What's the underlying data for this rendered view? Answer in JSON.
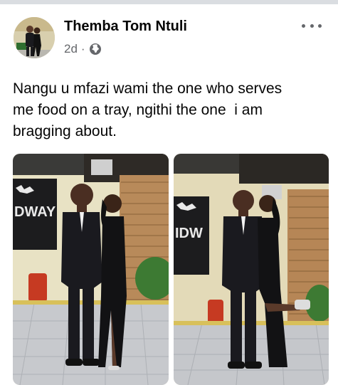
{
  "post": {
    "author": "Themba Tom Ntuli",
    "time": "2d",
    "separator": "·",
    "privacy_icon": "globe-icon",
    "more_icon": "more-options-icon",
    "caption": "Nangu u mfazi wami the one who serves\nme food on a tray, ngithi the one  i am\nbragging about.",
    "photos": [
      {
        "sign_text": "DWAY"
      },
      {
        "sign_text": "IDW"
      }
    ]
  },
  "colors": {
    "text_primary": "#050505",
    "text_secondary": "#65676b",
    "divider": "#dadde1"
  }
}
